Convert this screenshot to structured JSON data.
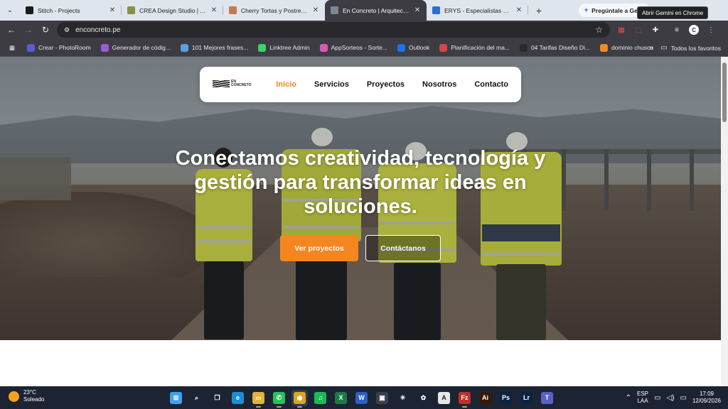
{
  "browser": {
    "tabs": [
      {
        "title": "Stitch - Projects",
        "fav_color": "#1b1b1b",
        "active": false
      },
      {
        "title": "CREA Design Studio | Agencia",
        "fav_color": "#8a8f45",
        "active": false
      },
      {
        "title": "Cherry Tortas y Postres | Alta",
        "fav_color": "#c47a4a",
        "active": false
      },
      {
        "title": "En Concreto | Arquitectura,",
        "fav_color": "#7c8794",
        "active": true
      },
      {
        "title": "ERYS - Especialistas en Lubric",
        "fav_color": "#2b6fd6",
        "active": false
      }
    ],
    "gemini_label": "Pregúntale a Gemini",
    "tooltip": "Abrir Gemini en Chrome",
    "url": "enconcreto.pe",
    "bookmarks": [
      {
        "label": "Crear - PhotoRoom",
        "color": "#5b5bd6"
      },
      {
        "label": "Generador de códig...",
        "color": "#9a5bd6"
      },
      {
        "label": "101 Mejores frases...",
        "color": "#5aa0e0"
      },
      {
        "label": "Linktree Admin",
        "color": "#3bd16f"
      },
      {
        "label": "AppSorteos - Sorte...",
        "color": "#d65bb4"
      },
      {
        "label": "Outlook",
        "color": "#1a73e8"
      },
      {
        "label": "Planificación del ma...",
        "color": "#d64545"
      },
      {
        "label": "04 Tarifas Diseño Di...",
        "color": "#2a2a2a"
      },
      {
        "label": "dominio chusco",
        "color": "#f08a24"
      }
    ],
    "bookmarks_overflow": "»",
    "all_bookmarks": "Todos los favoritos"
  },
  "site": {
    "logo_text": "EN CONCRETO",
    "nav": [
      {
        "label": "Inicio",
        "active": true
      },
      {
        "label": "Servicios",
        "active": false
      },
      {
        "label": "Proyectos",
        "active": false
      },
      {
        "label": "Nosotros",
        "active": false
      },
      {
        "label": "Contacto",
        "active": false
      }
    ],
    "headline": "Conectamos creatividad, tecnología y gestión para transformar ideas en soluciones.",
    "cta_primary": "Ver proyectos",
    "cta_secondary": "Contáctanos",
    "accent_color": "#f5861f"
  },
  "taskbar": {
    "weather_temp": "23°C",
    "weather_desc": "Soleado",
    "apps": [
      {
        "name": "start",
        "glyph": "⊞",
        "color": "#3ea2f0",
        "running": false
      },
      {
        "name": "search",
        "glyph": "⌕",
        "color": "#1c2433",
        "running": false
      },
      {
        "name": "task-view",
        "glyph": "❐",
        "color": "#1c2433",
        "running": false
      },
      {
        "name": "edge",
        "glyph": "e",
        "color": "#1a8fd6",
        "running": false
      },
      {
        "name": "file-explorer",
        "glyph": "▭",
        "color": "#e0b43a",
        "running": true
      },
      {
        "name": "whatsapp",
        "glyph": "✆",
        "color": "#27c15a",
        "running": true
      },
      {
        "name": "chrome",
        "glyph": "◉",
        "color": "#d9a620",
        "running": true,
        "focused": true
      },
      {
        "name": "spotify",
        "glyph": "♫",
        "color": "#1db954",
        "running": false
      },
      {
        "name": "excel",
        "glyph": "X",
        "color": "#1e7a45",
        "running": false
      },
      {
        "name": "word",
        "glyph": "W",
        "color": "#2b5fc2",
        "running": false
      },
      {
        "name": "store",
        "glyph": "▣",
        "color": "#3a3f4a",
        "running": false
      },
      {
        "name": "claude",
        "glyph": "✳",
        "color": "#1c2433",
        "running": false
      },
      {
        "name": "chatgpt",
        "glyph": "✿",
        "color": "#1c2433",
        "running": false
      },
      {
        "name": "inkscape",
        "glyph": "A",
        "color": "#e8e8e8",
        "running": false
      },
      {
        "name": "filezilla",
        "glyph": "Fz",
        "color": "#c0302a",
        "running": true
      },
      {
        "name": "illustrator",
        "glyph": "Ai",
        "color": "#3b1908",
        "running": false
      },
      {
        "name": "photoshop",
        "glyph": "Ps",
        "color": "#0b2540",
        "running": false
      },
      {
        "name": "lightroom",
        "glyph": "Lr",
        "color": "#0b2540",
        "running": false
      },
      {
        "name": "teams",
        "glyph": "T",
        "color": "#5b5fc7",
        "running": false
      }
    ],
    "lang_top": "ESP",
    "lang_bottom": "LAA",
    "time": "17:09",
    "date": "12/09/2026"
  }
}
